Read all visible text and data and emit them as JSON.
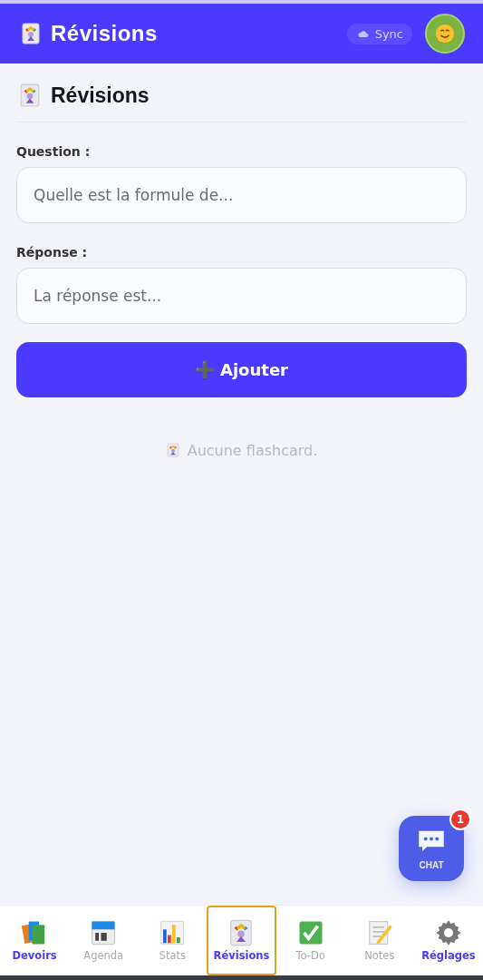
{
  "header": {
    "title": "Révisions",
    "sync": "Sync"
  },
  "page": {
    "title": "Révisions"
  },
  "form": {
    "fields": [
      {
        "label": "Question :",
        "placeholder": "Quelle est la formule de..."
      },
      {
        "label": "Réponse :",
        "placeholder": "La réponse est..."
      }
    ],
    "button": {
      "icon": "➕",
      "label": "Ajouter"
    }
  },
  "empty_message": "Aucune flashcard.",
  "chat": {
    "label": "CHAT",
    "badge": "1"
  },
  "nav": [
    {
      "label": "Devoirs",
      "kind": "books",
      "selected": false,
      "accent": true
    },
    {
      "label": "Agenda",
      "kind": "calendar",
      "selected": false,
      "accent": false
    },
    {
      "label": "Stats",
      "kind": "chart",
      "selected": false,
      "accent": false
    },
    {
      "label": "Révisions",
      "kind": "jester",
      "selected": true,
      "accent": true
    },
    {
      "label": "To-Do",
      "kind": "check",
      "selected": false,
      "accent": false
    },
    {
      "label": "Notes",
      "kind": "memo",
      "selected": false,
      "accent": false
    },
    {
      "label": "Réglages",
      "kind": "gear",
      "selected": false,
      "accent": true
    }
  ]
}
